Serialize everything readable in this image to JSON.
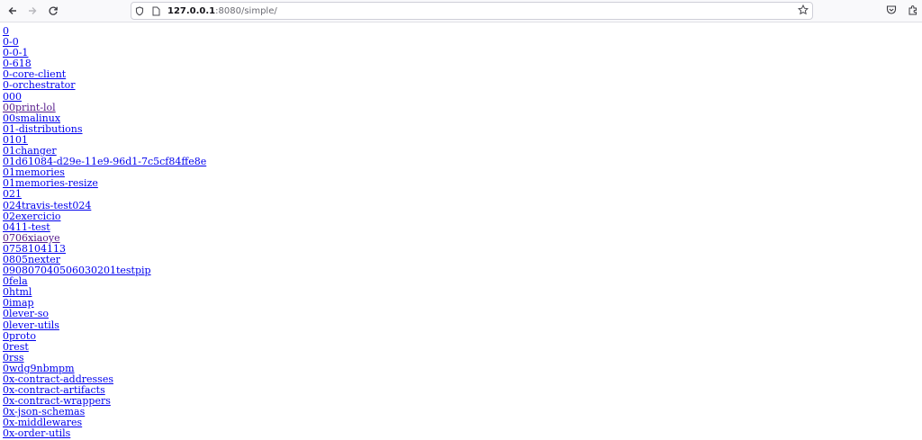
{
  "browser": {
    "url_host": "127.0.0.1",
    "url_rest": ":8080/simple/",
    "icons": {
      "back": "back-arrow-icon",
      "forward": "forward-arrow-icon",
      "reload": "reload-icon",
      "shield": "shield-icon",
      "page": "page-icon",
      "bookmark": "star-icon",
      "pocket": "pocket-icon",
      "extensions": "extensions-icon"
    }
  },
  "packages": [
    {
      "name": "0"
    },
    {
      "name": "0-0"
    },
    {
      "name": "0-0-1"
    },
    {
      "name": "0-618"
    },
    {
      "name": "0-core-client"
    },
    {
      "name": "0-orchestrator"
    },
    {
      "name": "000"
    },
    {
      "name": "00print-lol",
      "visited": true
    },
    {
      "name": "00smalinux"
    },
    {
      "name": "01-distributions"
    },
    {
      "name": "0101"
    },
    {
      "name": "01changer"
    },
    {
      "name": "01d61084-d29e-11e9-96d1-7c5cf84ffe8e"
    },
    {
      "name": "01memories"
    },
    {
      "name": "01memories-resize"
    },
    {
      "name": "021"
    },
    {
      "name": "024travis-test024"
    },
    {
      "name": "02exercicio"
    },
    {
      "name": "0411-test"
    },
    {
      "name": "0706xiaoye",
      "visited": true
    },
    {
      "name": "0758104113"
    },
    {
      "name": "0805nexter"
    },
    {
      "name": "090807040506030201testpip"
    },
    {
      "name": "0fela"
    },
    {
      "name": "0html"
    },
    {
      "name": "0imap"
    },
    {
      "name": "0lever-so"
    },
    {
      "name": "0lever-utils"
    },
    {
      "name": "0proto"
    },
    {
      "name": "0rest"
    },
    {
      "name": "0rss"
    },
    {
      "name": "0wdg9nbmpm"
    },
    {
      "name": "0x-contract-addresses"
    },
    {
      "name": "0x-contract-artifacts"
    },
    {
      "name": "0x-contract-wrappers"
    },
    {
      "name": "0x-json-schemas"
    },
    {
      "name": "0x-middlewares"
    },
    {
      "name": "0x-order-utils"
    }
  ],
  "colors": {
    "link": "#0000ee",
    "visited_link": "#551a8b",
    "toolbar_bg": "#f9f9fb"
  }
}
